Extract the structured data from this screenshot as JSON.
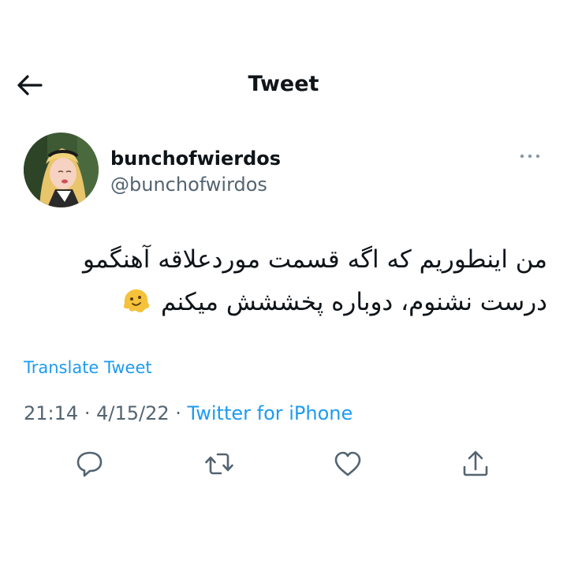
{
  "header": {
    "title": "Tweet",
    "back_icon": "arrow-left-icon"
  },
  "author": {
    "display_name": "bunchofwierdos",
    "handle": "@bunchofwirdos",
    "more_icon": "more-horizontal-icon"
  },
  "tweet": {
    "text_line1": "من اینطوریم که اگه قسمت موردعلاقه آهنگمو",
    "text_line2": "درست نشنوم، دوباره پخششش میکنم",
    "emoji": "melting-face-emoji",
    "translate_label": "Translate Tweet",
    "time": "21:14",
    "date": "4/15/22",
    "separator": "·",
    "source": "Twitter for iPhone"
  },
  "actions": [
    {
      "name": "reply",
      "icon": "reply-icon"
    },
    {
      "name": "retweet",
      "icon": "retweet-icon"
    },
    {
      "name": "like",
      "icon": "heart-icon"
    },
    {
      "name": "share",
      "icon": "share-icon"
    }
  ],
  "colors": {
    "link": "#1d9bf0",
    "secondary_text": "#536471",
    "primary_text": "#0f1419",
    "icon": "#536471"
  }
}
